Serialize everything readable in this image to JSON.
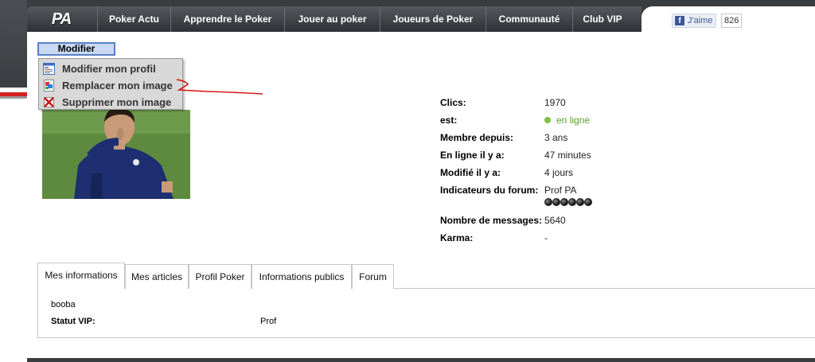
{
  "nav": {
    "logo": "PA",
    "items": [
      "Poker Actu",
      "Apprendre le Poker",
      "Jouer au poker",
      "Joueurs de Poker",
      "Communauté",
      "Club VIP"
    ]
  },
  "facebook": {
    "like_label": "J'aime",
    "count": "826"
  },
  "profile_menu": {
    "button_label": "Modifier",
    "items": [
      {
        "label": "Modifier mon profil",
        "icon": "edit-profile-icon"
      },
      {
        "label": "Remplacer mon image",
        "icon": "replace-image-icon"
      },
      {
        "label": "Supprimer mon image",
        "icon": "delete-image-icon"
      }
    ]
  },
  "profile_info": {
    "rows": [
      {
        "label": "Clics:",
        "value": "1970"
      },
      {
        "label": "est:",
        "value": "en ligne"
      },
      {
        "label": "Membre depuis:",
        "value": "3 ans"
      },
      {
        "label": "En ligne il y a:",
        "value": "47 minutes"
      },
      {
        "label": "Modifié il y a:",
        "value": "4 jours"
      },
      {
        "label": "Indicateurs du forum:",
        "value": "Prof PA"
      },
      {
        "label": "Nombre de messages:",
        "value": "5640"
      },
      {
        "label": "Karma:",
        "value": "-"
      }
    ],
    "forum_indicator_dots": 6
  },
  "tabs": [
    "Mes informations",
    "Mes articles",
    "Profil Poker",
    "Informations publics",
    "Forum"
  ],
  "active_tab": "Mes informations",
  "panel": {
    "username": "booba",
    "vip_label": "Statut VIP:",
    "vip_value": "Prof"
  },
  "colors": {
    "accent_red": "#d31f1f",
    "online_green": "#7ec242",
    "menu_button_bg": "#c9d9f2"
  }
}
